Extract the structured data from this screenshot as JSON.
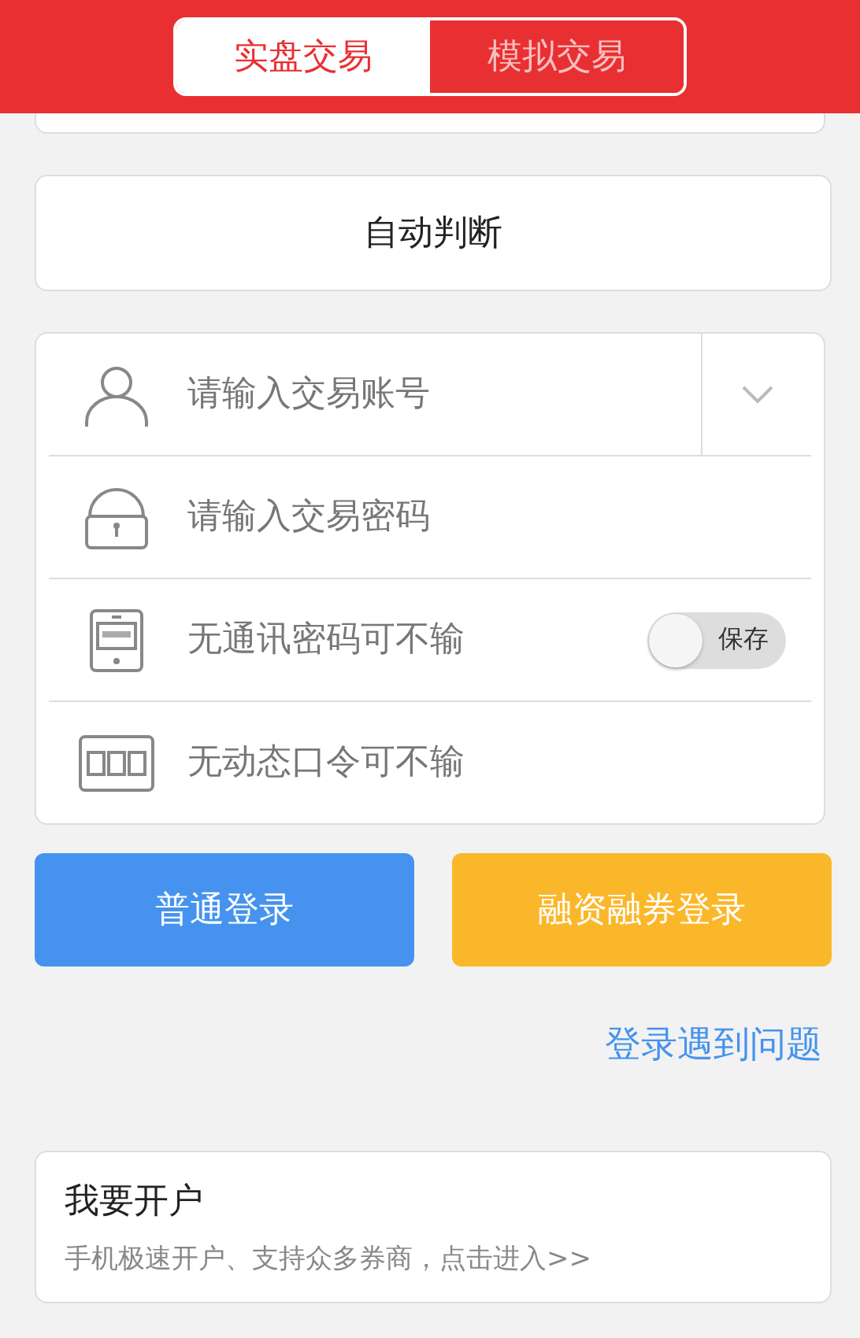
{
  "tabs": [
    {
      "label": "实盘交易",
      "selected": true
    },
    {
      "label": "模拟交易",
      "selected": false
    }
  ],
  "mode_selector": {
    "value": "自动判断"
  },
  "form": {
    "fields": [
      {
        "kind": "user",
        "placeholder": "请输入交易账号",
        "dropdown": true
      },
      {
        "kind": "lock",
        "placeholder": "请输入交易密码"
      },
      {
        "kind": "phone",
        "placeholder": "无通讯密码可不输",
        "toggle": {
          "label": "保存",
          "on": false
        }
      },
      {
        "kind": "token",
        "placeholder": "无动态口令可不输"
      }
    ]
  },
  "buttons": [
    {
      "kind": "primary",
      "label": "普通登录"
    },
    {
      "kind": "secondary",
      "label": "融资融券登录"
    }
  ],
  "help_link": "登录遇到问题",
  "open_account": {
    "title": "我要开户",
    "subtitle": "手机极速开户、支持众多券商，点击进入>>"
  }
}
